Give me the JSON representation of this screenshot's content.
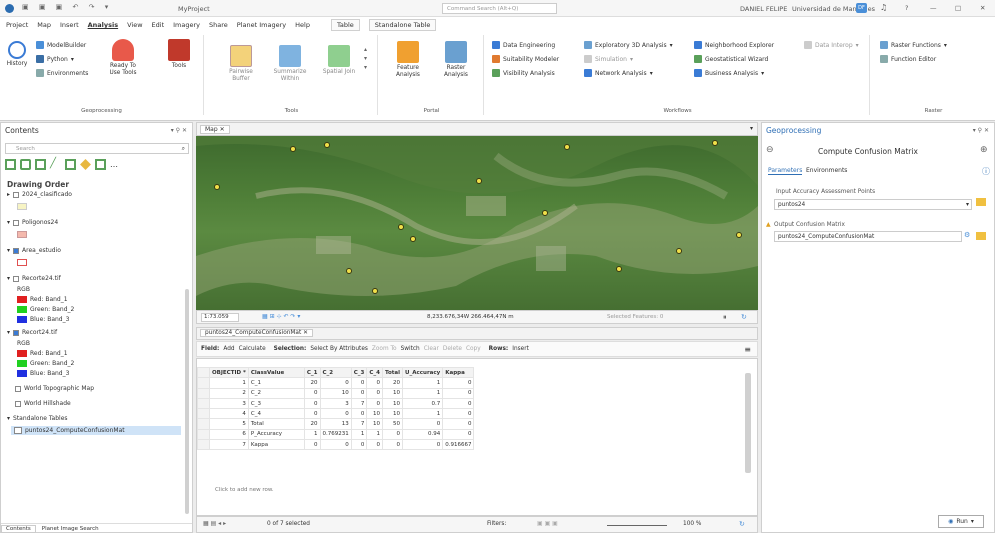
{
  "titlebar": {
    "project": "MyProject",
    "search_placeholder": "Command Search (Alt+Q)",
    "user": "DANIEL FELIPE",
    "org": "Universidad de Manizales",
    "user_initials": "DF",
    "help": "?",
    "minimize": "—",
    "maximize": "□",
    "close": "✕"
  },
  "menu": {
    "project": "Project",
    "map": "Map",
    "insert": "Insert",
    "analysis": "Analysis",
    "view": "View",
    "edit": "Edit",
    "imagery": "Imagery",
    "share": "Share",
    "planet": "Planet Imagery",
    "help": "Help",
    "table": "Table",
    "standalone": "Standalone Table"
  },
  "ribbon": {
    "history": "History",
    "modelbuilder": "ModelBuilder",
    "python": "Python",
    "environments": "Environments",
    "ready_to_use": "Ready To Use Tools",
    "tools": "Tools",
    "geoprocessing": "Geoprocessing",
    "pairwise_buffer": "Pairwise Buffer",
    "summarize_within": "Summarize Within",
    "spatial_join": "Spatial Join",
    "tools_group": "Tools",
    "feature_analysis": "Feature Analysis",
    "raster_analysis": "Raster Analysis",
    "portal": "Portal",
    "data_engineering": "Data Engineering",
    "suitability": "Suitability Modeler",
    "visibility": "Visibility Analysis",
    "exploratory3d": "Exploratory 3D Analysis",
    "simulation": "Simulation",
    "network": "Network Analysis",
    "neighborhood": "Neighborhood Explorer",
    "data_interop": "Data Interop",
    "geostat": "Geostatistical Wizard",
    "business": "Business Analysis",
    "workflows": "Workflows",
    "raster_functions": "Raster Functions",
    "function_editor": "Function Editor",
    "raster": "Raster"
  },
  "contents": {
    "title": "Contents",
    "search_placeholder": "Search",
    "drawing_order": "Drawing Order",
    "layers": [
      {
        "name": "2024_clasificado"
      },
      {
        "name": "Poligonos24"
      },
      {
        "name": "Area_estudio"
      },
      {
        "name": "Recorte24.tif"
      },
      {
        "name": "Recort24.tif"
      },
      {
        "name": "World Topographic Map"
      },
      {
        "name": "World Hillshade"
      }
    ],
    "rgb": "RGB",
    "red": "Red: Band_1",
    "green": "Green: Band_2",
    "blue": "Blue: Band_3",
    "standalone": "Standalone Tables",
    "table_item": "puntos24_ComputeConfusionMat",
    "tab_contents": "Contents",
    "tab_planet": "Planet Image Search"
  },
  "map": {
    "tab": "Map",
    "scale": "1:73.059",
    "coords": "8,233.676,34W 266.464,47N m",
    "selected": "Selected Features: 0"
  },
  "table": {
    "tab": "puntos24_ComputeConfusionMat",
    "field": "Field:",
    "add": "Add",
    "calculate": "Calculate",
    "selection": "Selection:",
    "select_by_attr": "Select By Attributes",
    "zoom_to": "Zoom To",
    "switch": "Switch",
    "clear": "Clear",
    "delete": "Delete",
    "copy": "Copy",
    "rows": "Rows:",
    "insert": "Insert",
    "headers": [
      "OBJECTID *",
      "ClassValue",
      "C_1",
      "C_2",
      "C_3",
      "C_4",
      "Total",
      "U_Accuracy",
      "Kappa"
    ],
    "rows_data": [
      [
        "1",
        "C_1",
        "20",
        "0",
        "0",
        "0",
        "20",
        "1",
        "0"
      ],
      [
        "2",
        "C_2",
        "0",
        "10",
        "0",
        "0",
        "10",
        "1",
        "0"
      ],
      [
        "3",
        "C_3",
        "0",
        "3",
        "7",
        "0",
        "10",
        "0.7",
        "0"
      ],
      [
        "4",
        "C_4",
        "0",
        "0",
        "0",
        "10",
        "10",
        "1",
        "0"
      ],
      [
        "5",
        "Total",
        "20",
        "13",
        "7",
        "10",
        "50",
        "0",
        "0"
      ],
      [
        "6",
        "P_Accuracy",
        "1",
        "0.769231",
        "1",
        "1",
        "0",
        "0.94",
        "0"
      ],
      [
        "7",
        "Kappa",
        "0",
        "0",
        "0",
        "0",
        "0",
        "0",
        "0.916667"
      ]
    ],
    "add_row": "Click to add new row.",
    "status": "0 of 7 selected",
    "filters": "Filters:",
    "zoom": "100 %"
  },
  "geoprocessing": {
    "title": "Geoprocessing",
    "tool": "Compute Confusion Matrix",
    "tab_params": "Parameters",
    "tab_env": "Environments",
    "input_label": "Input Accuracy Assessment Points",
    "input_value": "puntos24",
    "output_label": "Output Confusion Matrix",
    "output_value": "puntos24_ComputeConfusionMat",
    "run": "Run"
  }
}
